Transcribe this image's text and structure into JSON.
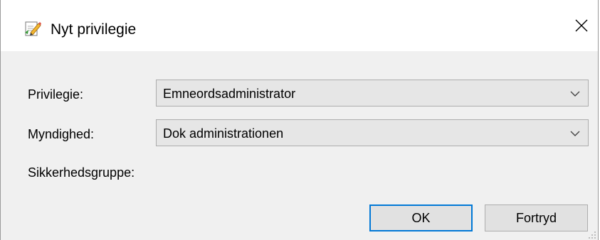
{
  "window": {
    "title": "Nyt privilegie",
    "title_icon": "edit-document-icon",
    "close_icon": "close-icon"
  },
  "form": {
    "privilege_label": "Privilegie:",
    "privilege_value": "Emneordsadministrator",
    "authority_label": "Myndighed:",
    "authority_value": "Dok administrationen",
    "security_group_label": "Sikkerhedsgruppe:"
  },
  "buttons": {
    "ok_label": "OK",
    "cancel_label": "Fortryd"
  },
  "colors": {
    "accent": "#0078d7",
    "dialog_background": "#f0f0f0",
    "combo_background": "#e6e6e6"
  }
}
